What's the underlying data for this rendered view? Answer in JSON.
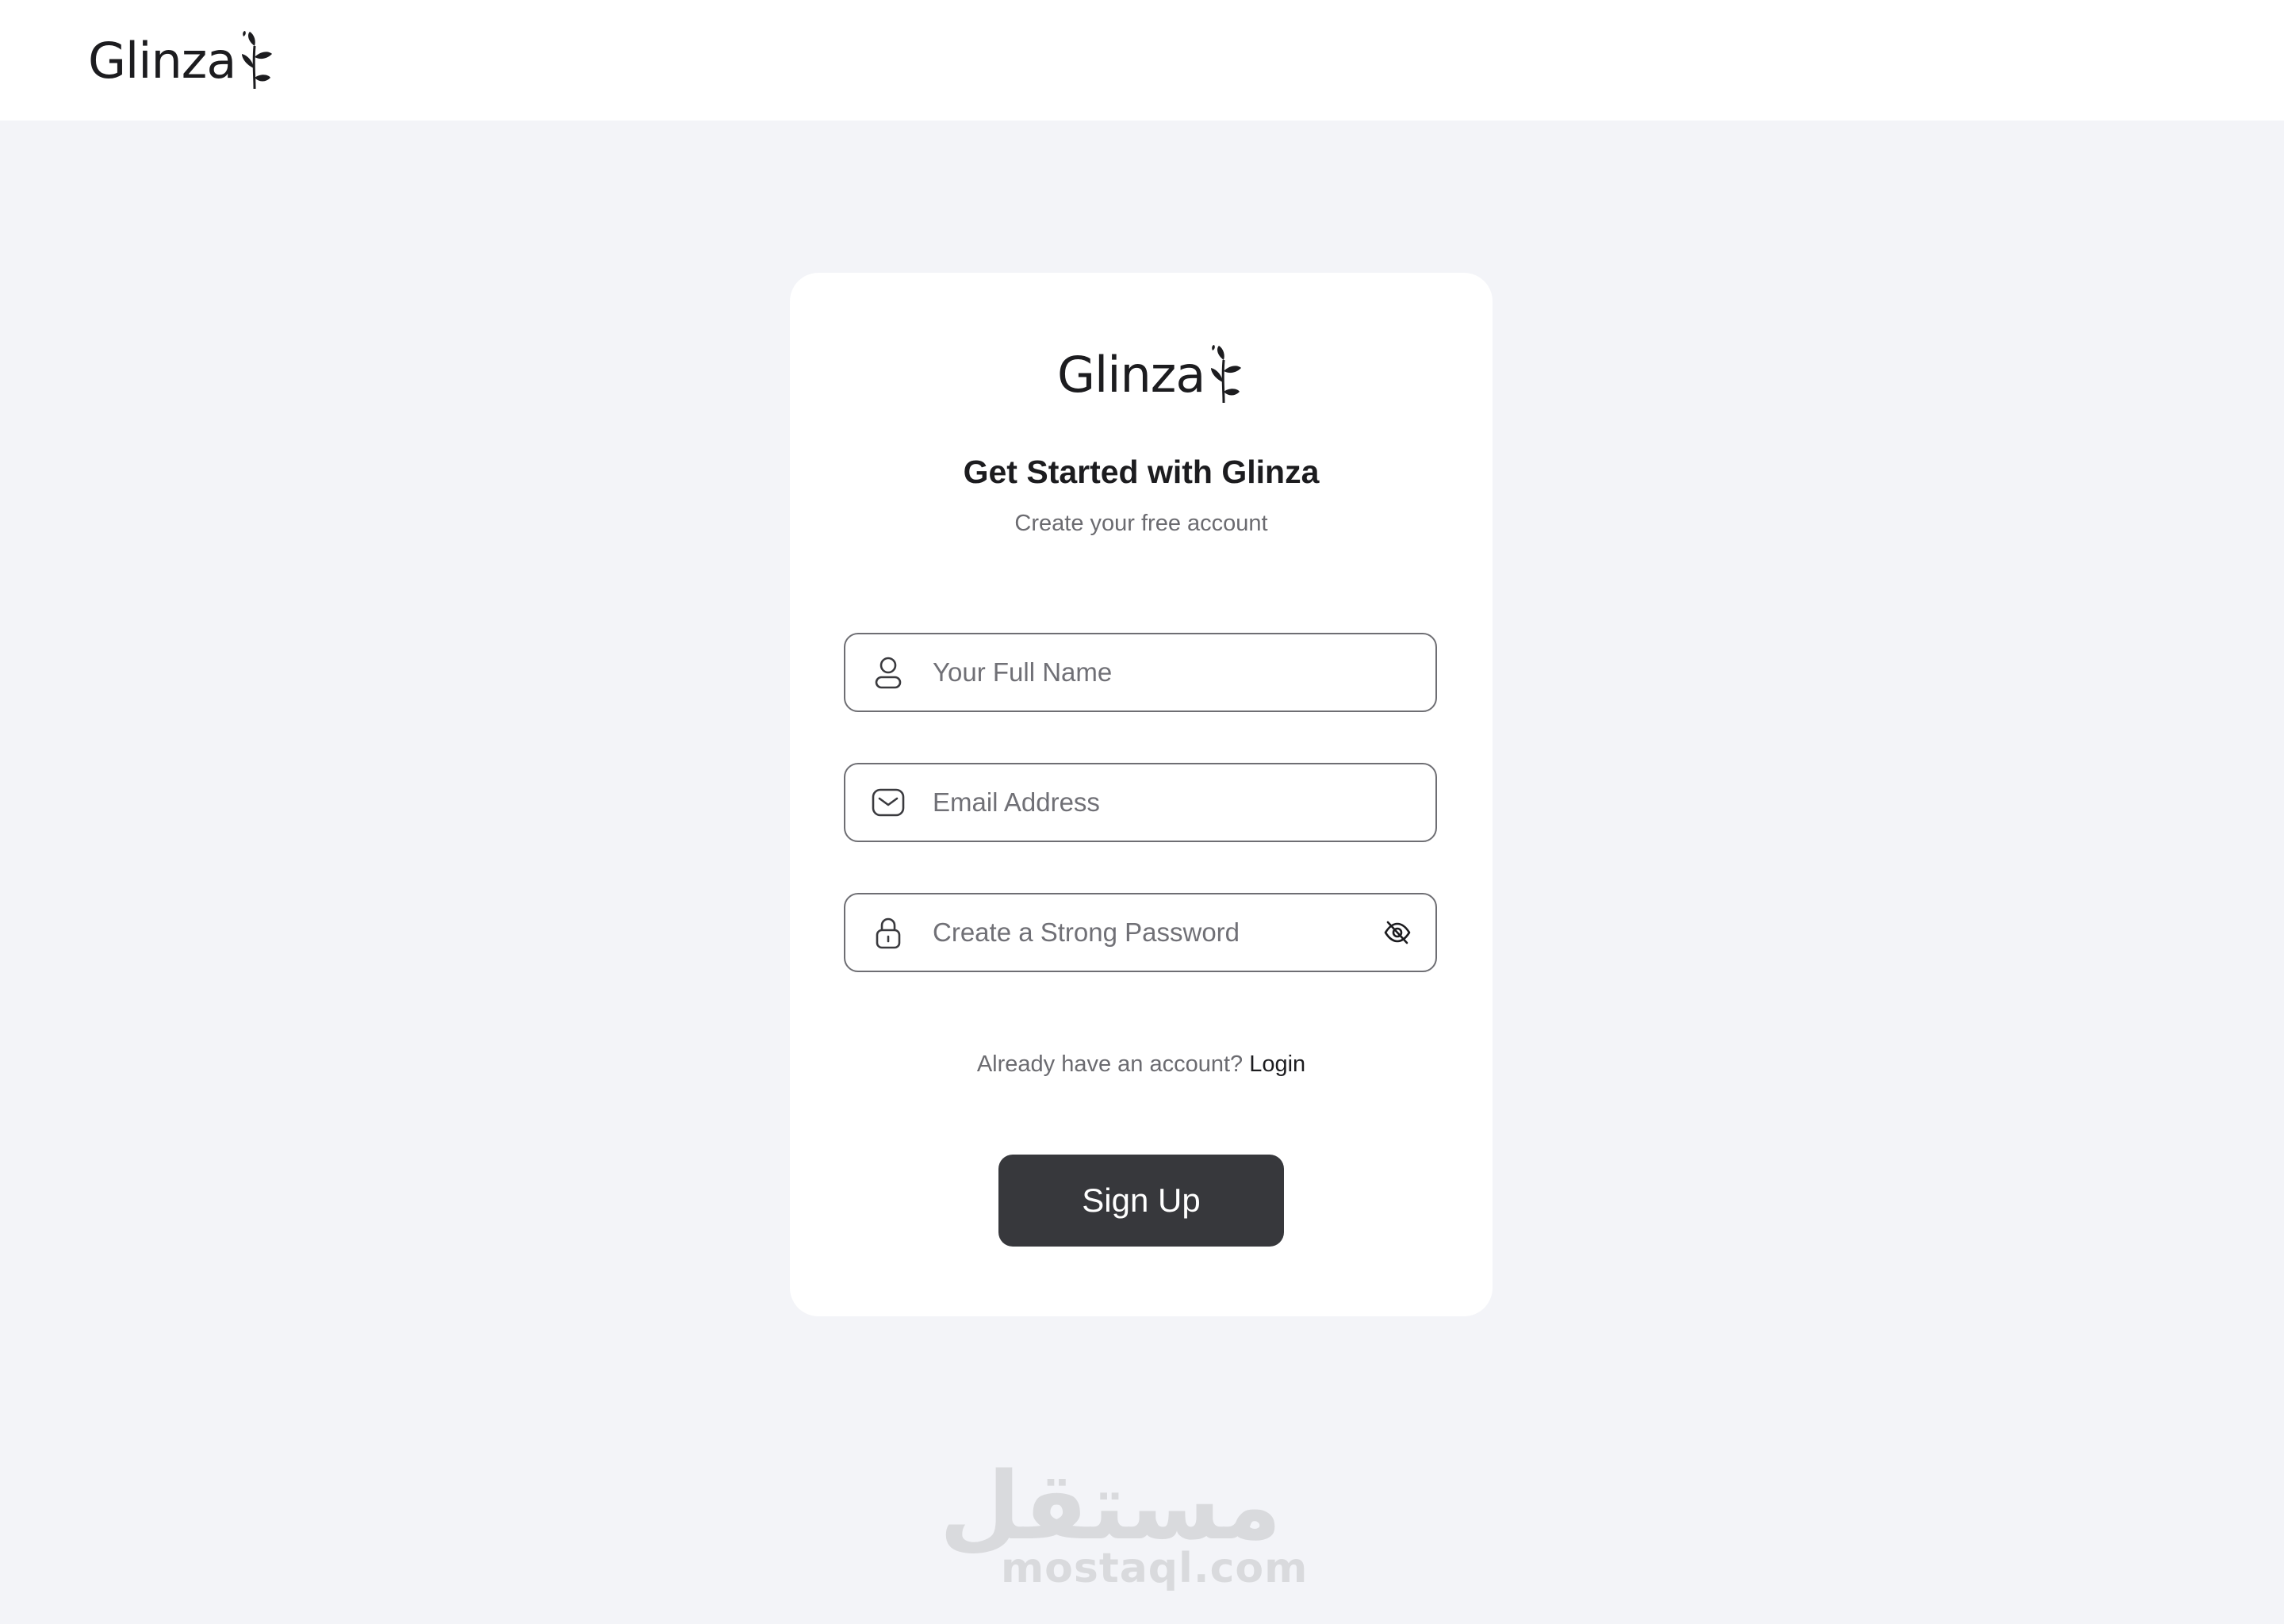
{
  "header": {
    "logo_text": "Glinza"
  },
  "card": {
    "logo_text": "Glinza",
    "title": "Get Started with Glinza",
    "subtitle": "Create your free account"
  },
  "form": {
    "full_name": {
      "placeholder": "Your Full Name",
      "value": "",
      "icon": "user-icon"
    },
    "email": {
      "placeholder": "Email Address",
      "value": "",
      "icon": "mail-icon"
    },
    "password": {
      "placeholder": "Create a Strong Password",
      "value": "",
      "icon": "lock-icon",
      "toggle_icon": "eye-off-icon"
    }
  },
  "login_prompt": {
    "text": "Already have an account?",
    "link_label": "Login"
  },
  "signup_button": {
    "label": "Sign Up"
  },
  "watermark": {
    "arabic": "مستقل",
    "latin": "mostaql.com"
  },
  "colors": {
    "page_background": "#f3f4f8",
    "card_background": "#ffffff",
    "button_background": "#37383c",
    "text_primary": "#1c1c1f",
    "text_muted": "#6b6b70"
  }
}
